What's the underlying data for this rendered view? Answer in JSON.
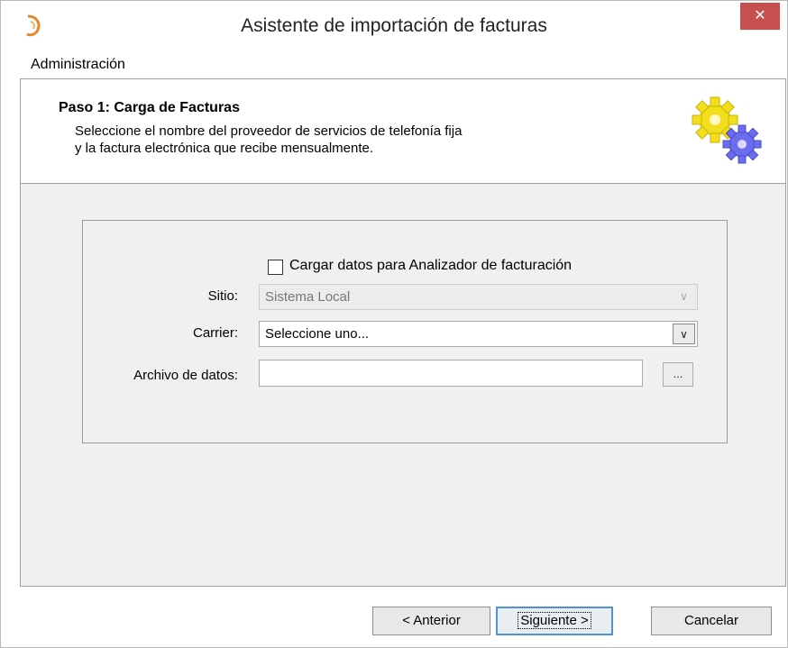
{
  "window": {
    "title": "Asistente de importación de facturas",
    "close_label": "✕"
  },
  "menu": {
    "items": [
      "Administración"
    ]
  },
  "header": {
    "step_title": "Paso 1: Carga de Facturas",
    "desc_line1": "Seleccione el nombre del proveedor de servicios de telefonía fija",
    "desc_line2": "y la factura electrónica que recibe mensualmente."
  },
  "form": {
    "checkbox_label": "Cargar datos para Analizador de facturación",
    "checkbox_checked": false,
    "sitio_label": "Sitio:",
    "sitio_value": "Sistema Local",
    "carrier_label": "Carrier:",
    "carrier_value": "Seleccione uno...",
    "archivo_label": "Archivo de datos:",
    "archivo_value": "",
    "browse_label": "..."
  },
  "buttons": {
    "anterior": "< Anterior",
    "siguiente": "Siguiente >",
    "cancelar": "Cancelar"
  },
  "colors": {
    "close_button": "#c7504f",
    "default_button_border": "#4f93d7",
    "panel_background": "#f0f0f0"
  }
}
